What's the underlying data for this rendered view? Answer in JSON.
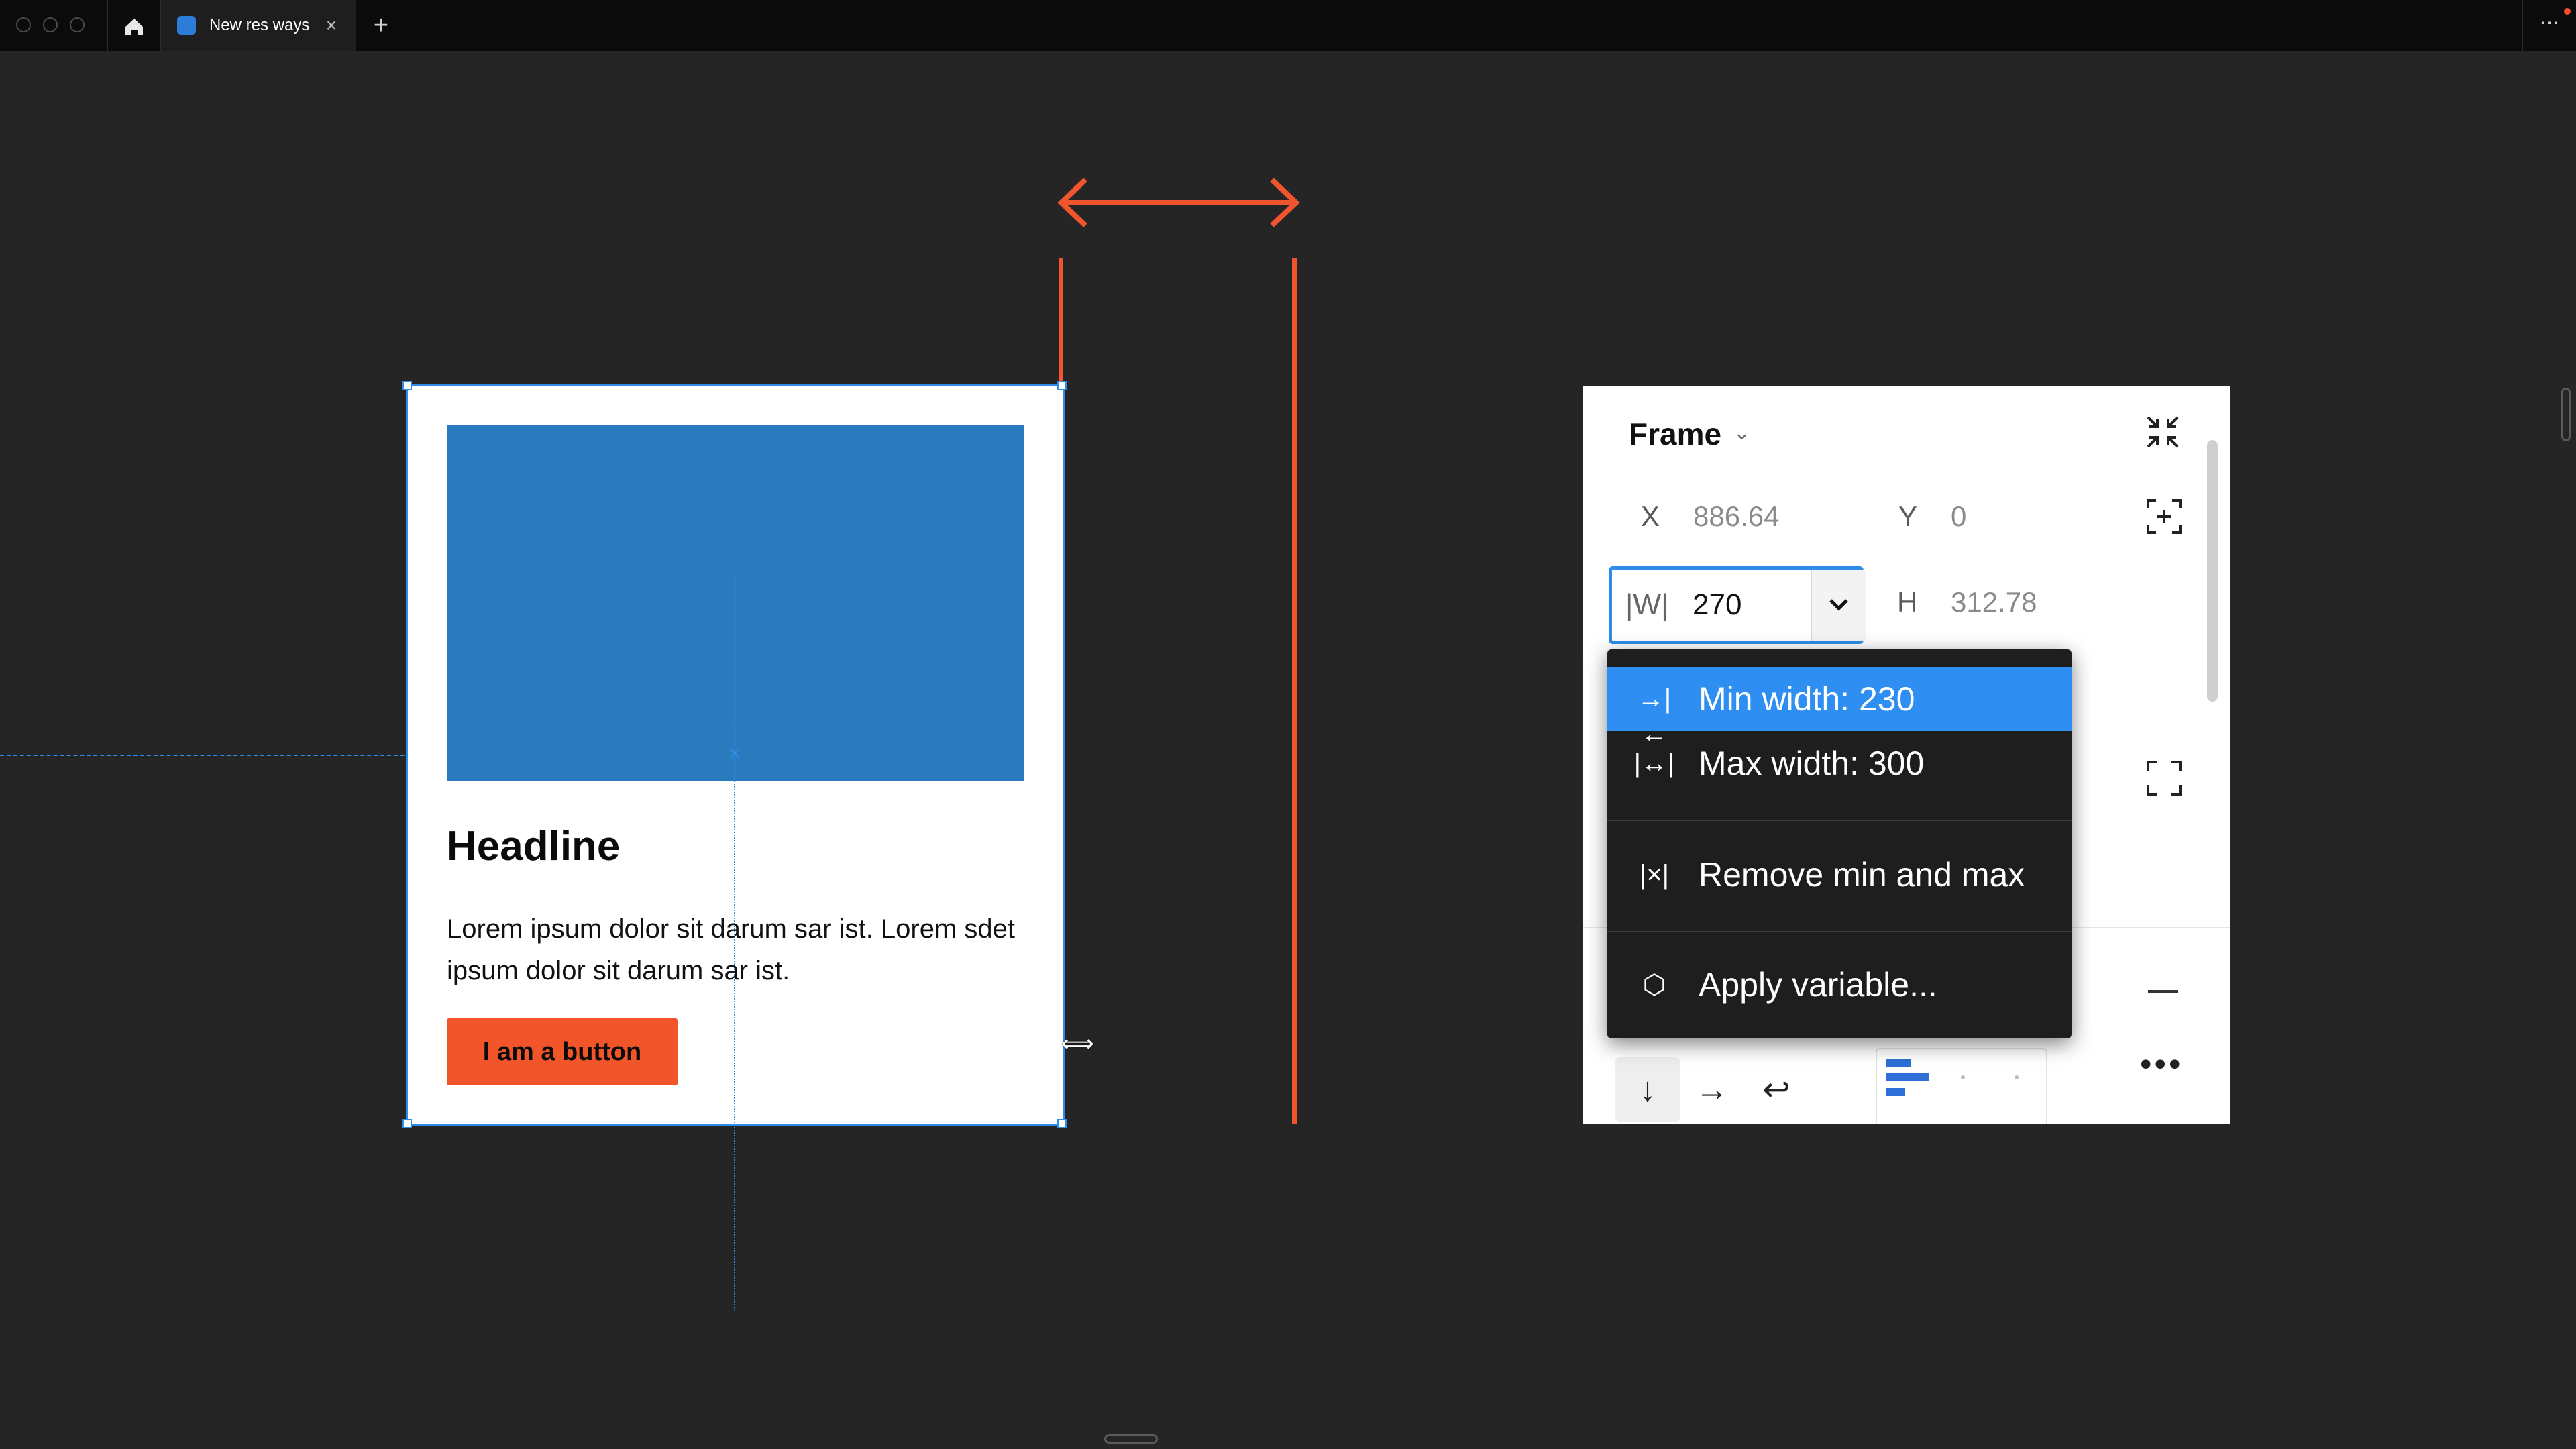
{
  "titlebar": {
    "tab_title": "New res ways",
    "tab_close": "×",
    "new_tab": "+",
    "more": "⋯"
  },
  "card": {
    "headline": "Headline",
    "body": "Lorem ipsum dolor sit darum sar ist. Lorem sdet ipsum dolor sit darum sar ist.",
    "button_label": "I am a button"
  },
  "panel": {
    "title": "Frame",
    "x_label": "X",
    "x_value": "886.64",
    "y_label": "Y",
    "y_value": "0",
    "w_label": "|W|",
    "w_value": "270",
    "h_label": "H",
    "h_value": "312.78"
  },
  "menu": {
    "items": [
      {
        "label": "Min width: 230",
        "icon": "min-width-icon"
      },
      {
        "label": "Max width: 300",
        "icon": "max-width-icon"
      },
      {
        "label": "Remove min and max",
        "icon": "remove-min-max-icon"
      },
      {
        "label": "Apply variable...",
        "icon": "variable-icon"
      }
    ]
  },
  "colors": {
    "accent_blue": "#2d8de8",
    "guide_red": "#f0552d",
    "button_orange": "#f3552a",
    "image_blue": "#2a7bbd"
  }
}
